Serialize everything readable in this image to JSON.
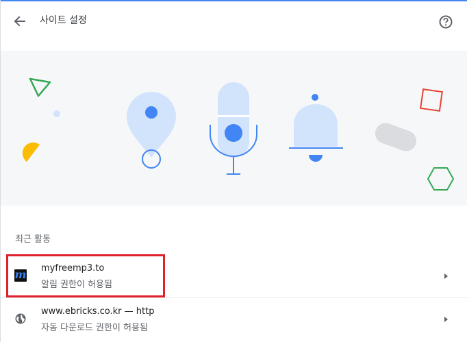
{
  "header": {
    "title": "사이트 설정",
    "back_icon": "arrow-back-icon",
    "help_icon": "help-circle-icon"
  },
  "colors": {
    "accent": "#4285f4",
    "highlight_border": "#e0202a",
    "hero_background": "#f6f7f9"
  },
  "hero": {
    "icons": [
      "location-pin-icon",
      "microphone-icon",
      "notification-bell-icon"
    ]
  },
  "recent_activity": {
    "title": "최근 활동",
    "items": [
      {
        "site": "myfreemp3.to",
        "status": "알림 권한이 허용됨",
        "favicon": "m",
        "highlighted": true
      },
      {
        "site": "www.ebricks.co.kr — http",
        "status": "자동 다운로드 권한이 허용됨",
        "favicon": "globe-icon",
        "highlighted": false
      }
    ]
  }
}
